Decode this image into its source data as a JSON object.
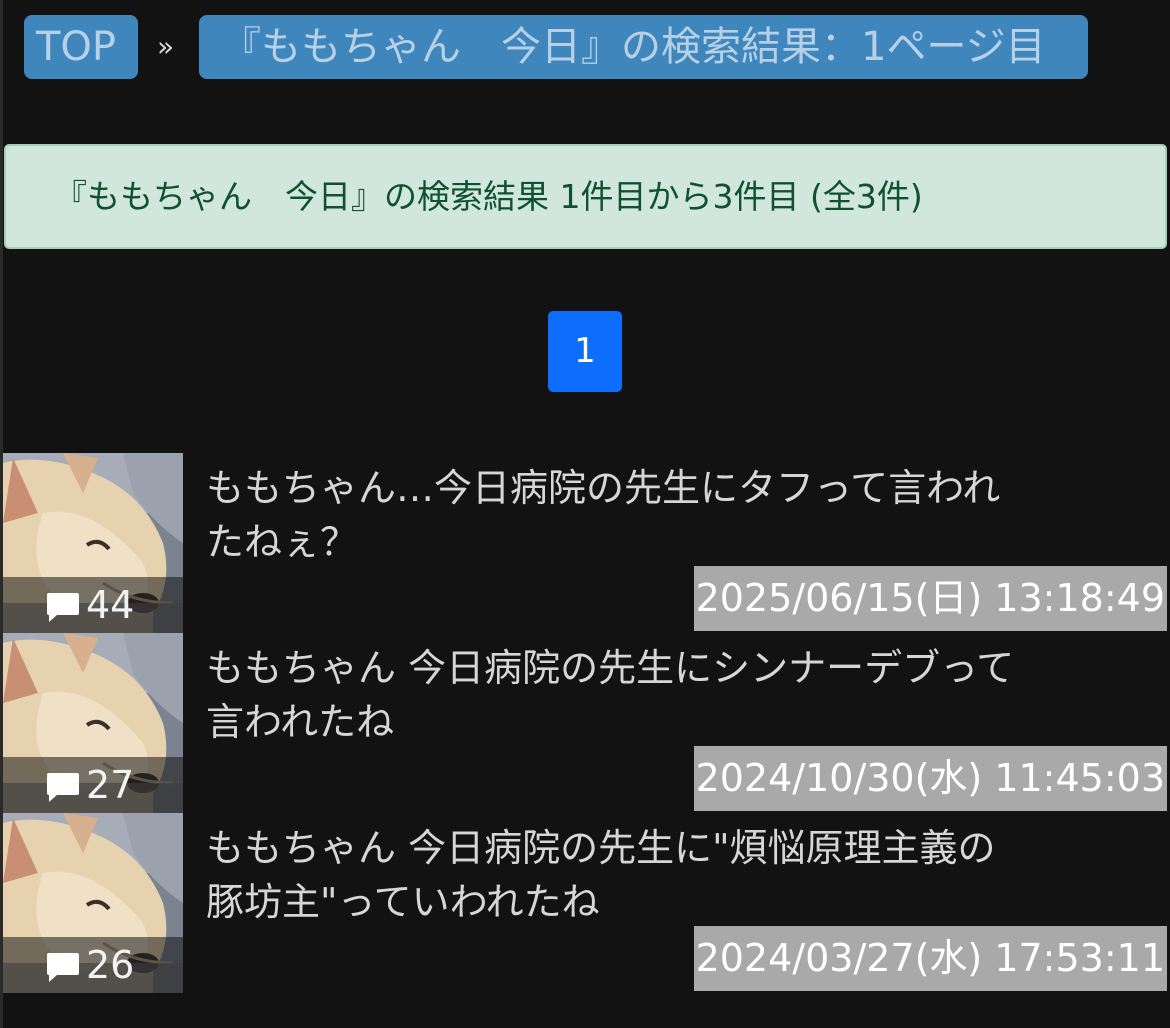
{
  "breadcrumb": {
    "top_label": "TOP",
    "separator": "»",
    "current_label": "『ももちゃん　今日』の検索結果：1ページ目"
  },
  "result_summary": "『ももちゃん　今日』の検索結果 1件目から3件目 (全3件)",
  "pagination": {
    "current_page": "1"
  },
  "items": [
    {
      "title": "ももちゃん…今日病院の先生にタフって言われたねぇ？",
      "comment_count": "44",
      "date": "2025/06/15(日) 13:18:49"
    },
    {
      "title": "ももちゃん 今日病院の先生にシンナーデブって言われたね",
      "comment_count": "27",
      "date": "2024/10/30(水) 11:45:03"
    },
    {
      "title": "ももちゃん 今日病院の先生に\"煩悩原理主義の豚坊主\"っていわれたね",
      "comment_count": "26",
      "date": "2024/03/27(水) 17:53:11"
    }
  ],
  "icons": {
    "comment": "comment-bubble-icon",
    "thumbnail": "dog-photo"
  },
  "colors": {
    "background": "#121212",
    "breadcrumb": "#3f86bd",
    "alert_bg": "#d1e7dd",
    "alert_text": "#0f5132",
    "page_button": "#0d6efd",
    "date_bg": "#a9a9a9"
  }
}
